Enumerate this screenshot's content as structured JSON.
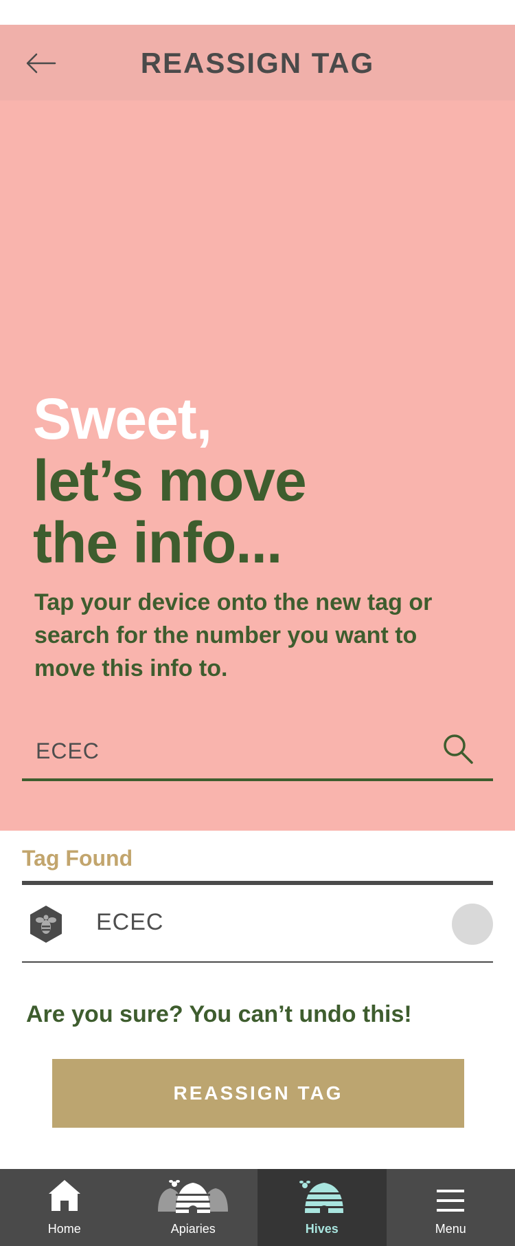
{
  "header": {
    "title": "REASSIGN TAG",
    "back_icon": "arrow-left-icon"
  },
  "hero": {
    "headline_line1": "Sweet,",
    "headline_line2": "let’s move",
    "headline_line3": "the info...",
    "subtext": "Tap your device onto the new tag or search for the number you want to move this info to."
  },
  "search": {
    "value": "ECEC",
    "icon": "search-icon"
  },
  "result": {
    "section_label": "Tag Found",
    "tag_name": "ECEC",
    "tag_icon": "bee-hexagon-icon"
  },
  "confirm": {
    "warning": "Are you sure? You can’t undo this!",
    "button_label": "REASSIGN TAG"
  },
  "nav": {
    "items": [
      {
        "label": "Home",
        "icon": "home-icon",
        "active": false
      },
      {
        "label": "Apiaries",
        "icon": "apiaries-icon",
        "active": false
      },
      {
        "label": "Hives",
        "icon": "hive-icon",
        "active": true
      },
      {
        "label": "Menu",
        "icon": "menu-icon",
        "active": false
      }
    ]
  },
  "colors": {
    "header_bg": "#f0b0aa",
    "hero_bg": "#f9b4ad",
    "primary_green": "#3e5d2e",
    "gold": "#bca570",
    "nav_bg": "#4a4a4a",
    "nav_active": "#a9e5df"
  }
}
